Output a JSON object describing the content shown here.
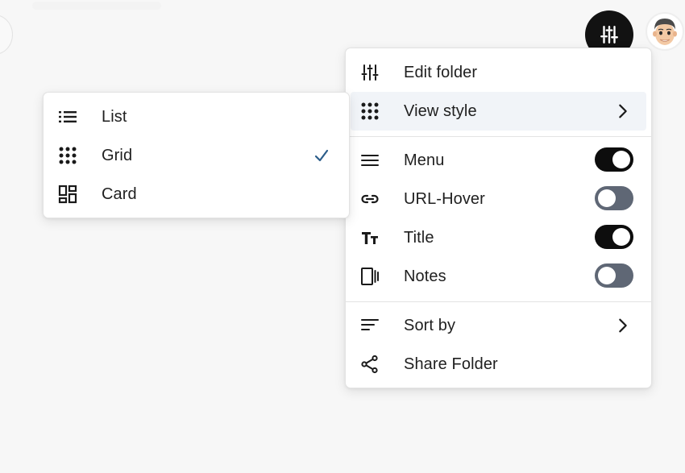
{
  "main_menu": {
    "edit_folder": "Edit folder",
    "view_style": "View style",
    "menu": "Menu",
    "url_hover": "URL-Hover",
    "title": "Title",
    "notes": "Notes",
    "sort_by": "Sort by",
    "share_folder": "Share Folder",
    "toggles": {
      "menu": true,
      "url_hover": false,
      "title": true,
      "notes": false
    }
  },
  "view_style_menu": {
    "list": "List",
    "grid": "Grid",
    "card": "Card",
    "selected": "Grid"
  },
  "colors": {
    "toggle_on": "#0d0d0d",
    "toggle_off": "#5f6775",
    "checkmark": "#2c5d8a",
    "active_row": "#f1f4f8"
  },
  "icons": {
    "settings_button": "sliders-icon",
    "edit_folder": "sliders-icon",
    "view_style": "grid-dots-icon",
    "menu": "hamburger-icon",
    "url_hover": "link-icon",
    "title": "text-size-icon",
    "notes": "notes-panel-icon",
    "sort_by": "sort-lines-icon",
    "share_folder": "share-icon",
    "list": "list-icon",
    "grid": "grid-dots-icon",
    "card": "card-layout-icon"
  }
}
